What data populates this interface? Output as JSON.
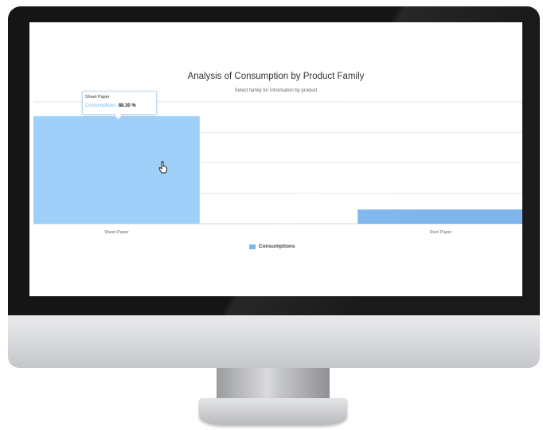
{
  "chart_data": {
    "type": "bar",
    "title": "Analysis of Consumption by Product Family",
    "subtitle": "Select family for information by product",
    "categories": [
      "Sheet Paper",
      "Reel Paper"
    ],
    "series": [
      {
        "name": "Consumptions",
        "values": [
          88.3,
          11.7
        ],
        "color": "#7cb5ec"
      }
    ],
    "ylim": [
      0,
      100
    ],
    "grid": true,
    "legend": "bottom-center",
    "hovered_category_index": 0
  },
  "tooltip": {
    "header": "Sheet Paper",
    "series_label": "Consumptions:",
    "value": "88.30 %"
  },
  "colors": {
    "bar_hovered": "#9fd0fa",
    "bar": "#7cb5ec",
    "grid": "#e6e6e6"
  }
}
